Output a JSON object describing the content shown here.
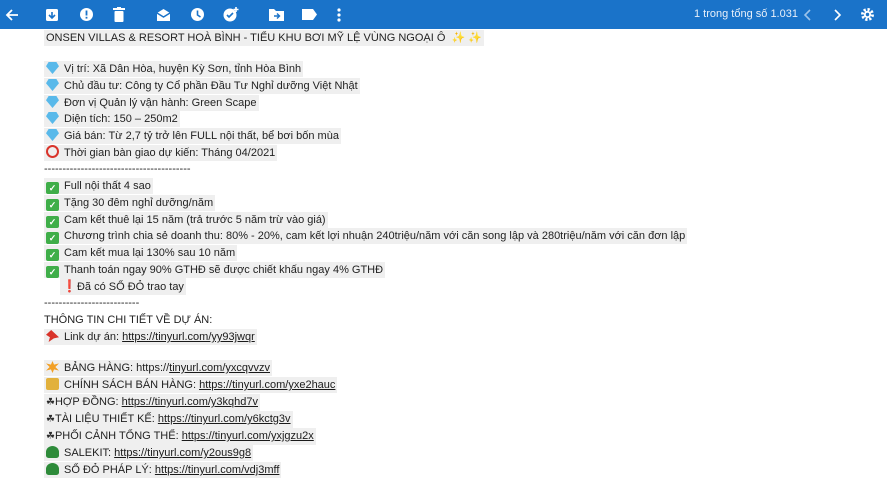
{
  "toolbar": {
    "count_text": "1 trong tổng số 1.031",
    "icons": [
      "back-arrow-icon",
      "archive-icon",
      "report-spam-icon",
      "delete-icon",
      "mark-unread-icon",
      "snooze-icon",
      "add-task-icon",
      "move-to-icon",
      "label-icon",
      "more-icon",
      "prev-icon",
      "next-icon",
      "settings-icon"
    ]
  },
  "email": {
    "title": "ONSEN VILLAS & RESORT HOÀ BÌNH - TIỂU KHU BƠI MỸ LỆ VÙNG NGOẠI Ô",
    "info": [
      "Vị trí: Xã Dân Hòa, huyện Kỳ Sơn, tỉnh Hòa Bình",
      "Chủ đầu tư: Công ty Cổ phần Đầu Tư Nghỉ dưỡng Việt Nhật",
      "Đơn vị Quản lý vận hành: Green Scape",
      "Diện tích: 150 – 250m2",
      "Giá bán:  Từ 2,7 tỷ trở lên FULL nội thất, bể bơi bốn mùa",
      "Thời gian bàn giao dự kiến: Tháng 04/2021"
    ],
    "divider1": "----------------------------------------",
    "benefits": [
      "Full nội thất 4 sao",
      "Tặng 30 đêm nghỉ dưỡng/năm",
      "Cam kết thuê lại 15 năm (trả trước 5 năm trừ vào giá)",
      "Chương trình chia sẻ doanh thu: 80% - 20%, cam kết lợi nhuận 240triệu/năm với căn song lập và 280triệu/năm với căn đơn lập",
      "Cam kết mua lại 130% sau 10 năm",
      "Thanh toán ngay 90% GTHĐ sẽ được chiết khấu ngay 4% GTHĐ",
      "Đã có SỔ ĐỎ trao tay"
    ],
    "divider2": "--------------------------",
    "details_heading": "THÔNG TIN CHI TIẾT VỀ DỰ ÁN:",
    "project_link_label": "Link dự án: ",
    "project_link": "https://tinyurl.com/yy93jwqr",
    "links": [
      {
        "label": "BẢNG HÀNG: https://",
        "url": "tinyurl.com/yxcqvvzv"
      },
      {
        "label": "CHÍNH SÁCH BÁN HÀNG: ",
        "url": "https://tinyurl.com/yxe2hauc"
      },
      {
        "label": "HỢP ĐỒNG: ",
        "url": "https://tinyurl.com/y3kqhd7v"
      },
      {
        "label": "TÀI LIỆU THIẾT KẾ: ",
        "url": "https://tinyurl.com/y6kctg3v"
      },
      {
        "label": "PHỐI CẢNH TỔNG THỂ: ",
        "url": "https://tinyurl.com/yxjgzu2x"
      },
      {
        "label": "SALEKIT: ",
        "url": "https://tinyurl.com/y2ous9g8"
      },
      {
        "label": "SỔ ĐỎ PHÁP LÝ: ",
        "url": "https://tinyurl.com/vdj3mff"
      }
    ],
    "colors": {
      "toolbar": "#1a73c9",
      "highlight": "#efefef"
    }
  }
}
